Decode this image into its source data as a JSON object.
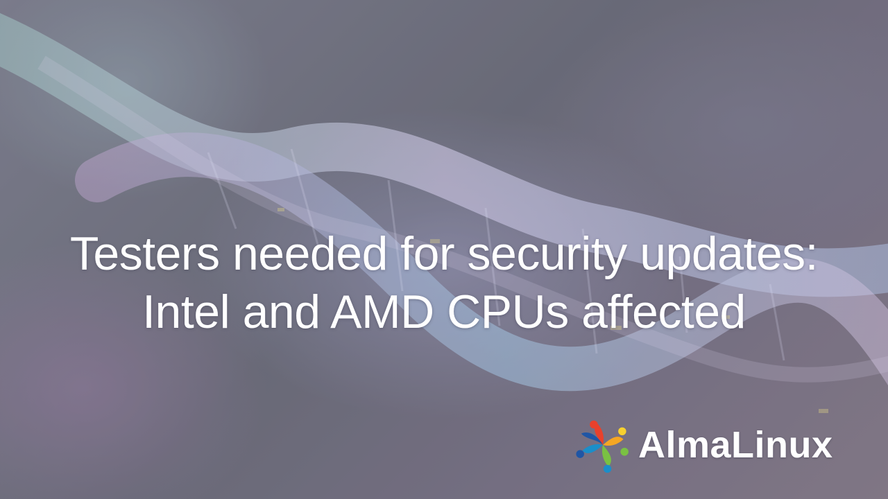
{
  "headline": {
    "line1": "Testers needed for security updates:",
    "line2": "Intel and AMD CPUs affected"
  },
  "brand": {
    "name": "AlmaLinux",
    "logo_icon": "almalinux-logo-icon",
    "colors": {
      "red": "#e8412c",
      "orange": "#f5a623",
      "yellow": "#f8d12f",
      "green": "#7ac143",
      "blue": "#1b8ec9",
      "navy": "#1f56a5"
    }
  },
  "background": {
    "motif": "dna-helix-icon"
  }
}
